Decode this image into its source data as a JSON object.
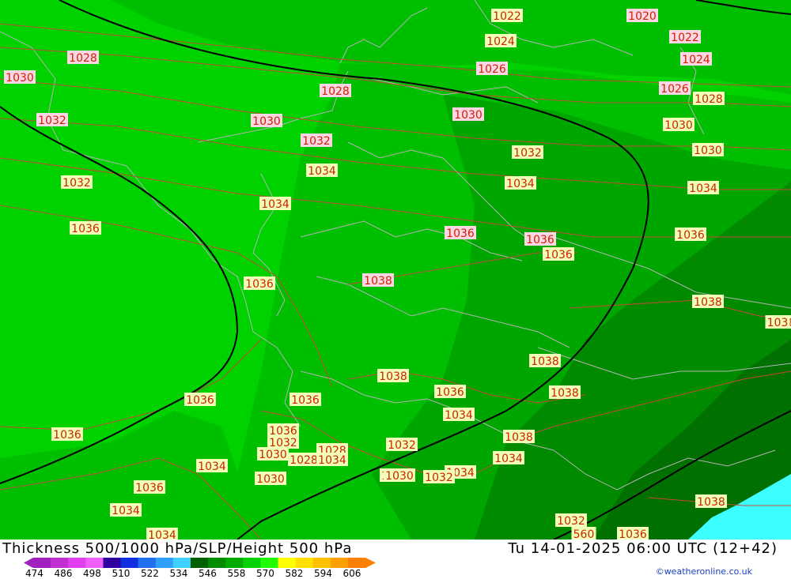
{
  "title": "Thickness 500/1000 hPa/SLP/Height 500 hPa",
  "timestamp": "Tu 14-01-2025 06:00 UTC (12+42)",
  "credit": "©weatheronline.co.uk",
  "colors": {
    "background": "#00d200",
    "thickness_bands": [
      "#00d200",
      "#00be00",
      "#00a600",
      "#008a00",
      "#007000"
    ],
    "isobar": "#c44a3a",
    "height_500": "#000000",
    "borders": "#b4b4b4",
    "cold_region": "#3dffff"
  },
  "legend": {
    "values": [
      "474",
      "486",
      "498",
      "510",
      "522",
      "534",
      "546",
      "558",
      "570",
      "582",
      "594",
      "606"
    ],
    "colors": [
      "#a020c0",
      "#c030d0",
      "#e040f0",
      "#f060ff",
      "#3000a0",
      "#1030e0",
      "#2070f0",
      "#30a0ff",
      "#40d0ff",
      "#006000",
      "#008c00",
      "#00aa00",
      "#00d200",
      "#20ff00",
      "#ffff00",
      "#ffe000",
      "#ffc000",
      "#ff9f00",
      "#ff8000"
    ]
  },
  "pressure_labels": [
    "1022",
    "1020",
    "1024",
    "1022",
    "1026",
    "1024",
    "1028",
    "1030",
    "1028",
    "1026",
    "1028",
    "1030",
    "1032",
    "1030",
    "1030",
    "1032",
    "1030",
    "1032",
    "1032",
    "1034",
    "1034",
    "1034",
    "1034",
    "1036",
    "1036",
    "1036",
    "1036",
    "1036",
    "1038",
    "1038",
    "1036",
    "1038",
    "1038",
    "103",
    "1038",
    "1038",
    "1036",
    "1036",
    "1036",
    "1034",
    "1036",
    "1034",
    "1032",
    "1038",
    "1036",
    "1032",
    "1030",
    "1028",
    "1028",
    "1034",
    "1032",
    "1034",
    "1034",
    "1036",
    "1030",
    "1030",
    "1032",
    "1034",
    "1034",
    "1032",
    "1038",
    "1036",
    "1032",
    "560"
  ]
}
